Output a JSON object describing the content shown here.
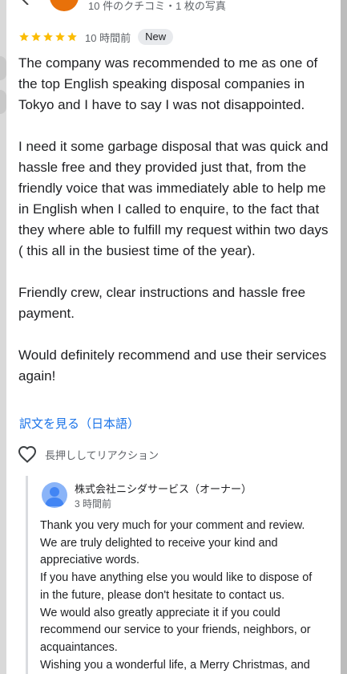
{
  "header": {
    "reviewer_meta": "10 件のクチコミ・1 枚の写真"
  },
  "review": {
    "stars": 5,
    "time_ago": "10 時間前",
    "badge": "New",
    "paragraphs": [
      "The company was recommended to me as one of the top English speaking disposal companies in Tokyo and I have to say I was not disappointed.",
      "I need it some garbage disposal that was quick and hassle free and they provided just that, from the friendly voice that was immediately able to help me in English when I called to enquire, to the fact that they where able to fulfill my request within two days ( this all in the busiest time of the year).",
      "Friendly crew, clear instructions and hassle free payment.",
      "Would definitely recommend and use their services again!"
    ],
    "translate_link": "訳文を見る（日本語）",
    "reaction_label": "長押ししてリアクション"
  },
  "owner_reply": {
    "name": "株式会社ニシダサービス（オーナー）",
    "time_ago": "3 時間前",
    "lines": [
      "Thank you very much for your comment and review.",
      "We are truly delighted to receive your kind and",
      "appreciative words.",
      "If you have anything else you would like to dispose of",
      "in the future, please don't hesitate to contact us.",
      "We would also greatly appreciate it if you could",
      "recommend our service to your friends, neighbors, or",
      "acquaintances.",
      "Wishing you a wonderful life, a Merry Christmas, and"
    ]
  },
  "colors": {
    "star": "#fbbc04",
    "link": "#1a73e8",
    "accent_avatar": "#e8710a"
  }
}
